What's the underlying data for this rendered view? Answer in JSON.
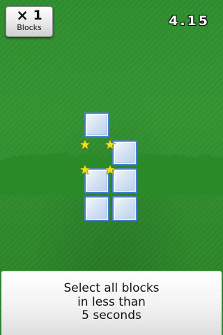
{
  "hud": {
    "blocks_count": "1",
    "blocks_label": "Blocks",
    "timer": "4.15"
  },
  "icons": {
    "multiply": "×-icon",
    "star": "star-icon"
  },
  "board": {
    "blocks": [
      {
        "col": 0,
        "row": 0
      },
      {
        "col": 1,
        "row": 1
      },
      {
        "col": 0,
        "row": 2
      },
      {
        "col": 1,
        "row": 2
      },
      {
        "col": 0,
        "row": 3
      },
      {
        "col": 1,
        "row": 3
      }
    ],
    "block_color": "#d6e4f5",
    "star_color": "#e8e020"
  },
  "instruction": {
    "text": "Select all blocks\nin less than\n5 seconds"
  },
  "colors": {
    "field_green": "#33932f",
    "crowd_green": "#2a8a28"
  }
}
